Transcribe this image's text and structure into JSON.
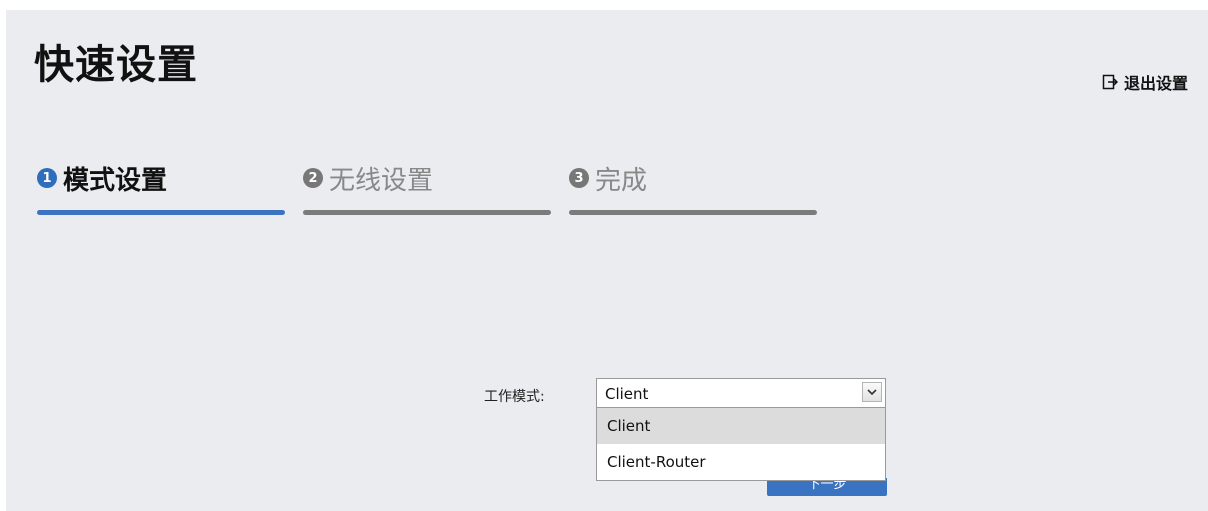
{
  "header": {
    "title": "快速设置",
    "exit_label": "退出设置"
  },
  "steps": [
    {
      "num": "1",
      "label": "模式设置",
      "active": true
    },
    {
      "num": "2",
      "label": "无线设置",
      "active": false
    },
    {
      "num": "3",
      "label": "完成",
      "active": false
    }
  ],
  "form": {
    "mode_label": "工作模式:",
    "mode_value": "Client",
    "options": [
      "Client",
      "Client-Router"
    ],
    "next_label": "下一步"
  },
  "colors": {
    "accent": "#3b73c0",
    "inactive_bar": "#7b7b7b",
    "background": "#ebecf0"
  },
  "icons": {
    "exit": "exit-icon",
    "dropdown": "chevron-down-icon"
  }
}
